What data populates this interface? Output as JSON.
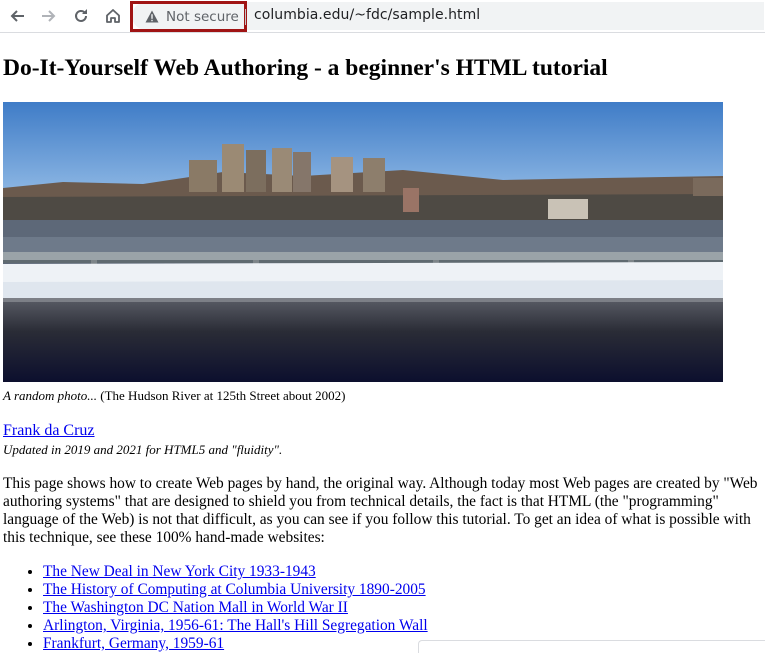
{
  "browser": {
    "security_label": "Not secure",
    "url": "columbia.edu/~fdc/sample.html"
  },
  "page": {
    "title": "Do-It-Yourself Web Authoring - a beginner's HTML tutorial",
    "caption_italic": "A random photo...",
    "caption_rest": " (The Hudson River at 125th Street about 2002)",
    "author_link": "Frank da Cruz",
    "updated": "Updated in 2019 and 2021 for HTML5 and \"fluidity\".",
    "intro": "This page shows how to create Web pages by hand, the original way. Although today most Web pages are created by \"Web authoring systems\" that are designed to shield you from technical details, the fact is that HTML (the \"programming\" language of the Web) is not that difficult, as you can see if you follow this tutorial. To get an idea of what is possible with this technique, see these 100% hand-made websites:",
    "links": [
      "The New Deal in New York City 1933-1943",
      "The History of Computing at Columbia University 1890-2005",
      "The Washington DC Nation Mall in World War II",
      "Arlington, Virginia, 1956-61: The Hall's Hill Segregation Wall",
      "Frankfurt, Germany, 1959-61"
    ]
  },
  "icons": {
    "back": "arrow-left-icon",
    "forward": "arrow-right-icon",
    "reload": "reload-icon",
    "home": "home-icon",
    "warning": "warning-triangle-icon"
  }
}
